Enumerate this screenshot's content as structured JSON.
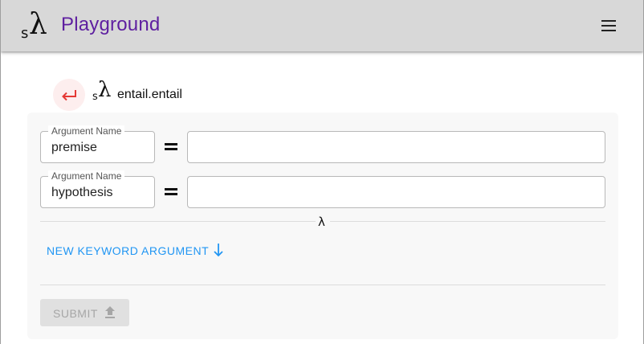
{
  "appbar": {
    "logo_s": "s",
    "logo_lambda": "λ",
    "title": "Playground",
    "title_color": "#5e1fa0",
    "menu_icon": "hamburger-menu-icon"
  },
  "function": {
    "back_icon": "return-arrow-icon",
    "logo_s": "s",
    "logo_lambda": "λ",
    "name": "entail.entail"
  },
  "arguments": [
    {
      "name_label": "Argument Name",
      "name": "premise",
      "value": ""
    },
    {
      "name_label": "Argument Name",
      "name": "hypothesis",
      "value": ""
    }
  ],
  "separator_symbol": "λ",
  "actions": {
    "new_keyword_label": "NEW KEYWORD ARGUMENT",
    "new_keyword_icon": "arrow-down-icon",
    "accent_color": "#2196f3",
    "submit_label": "SUBMIT",
    "submit_icon": "upload-icon",
    "submit_disabled": true
  }
}
